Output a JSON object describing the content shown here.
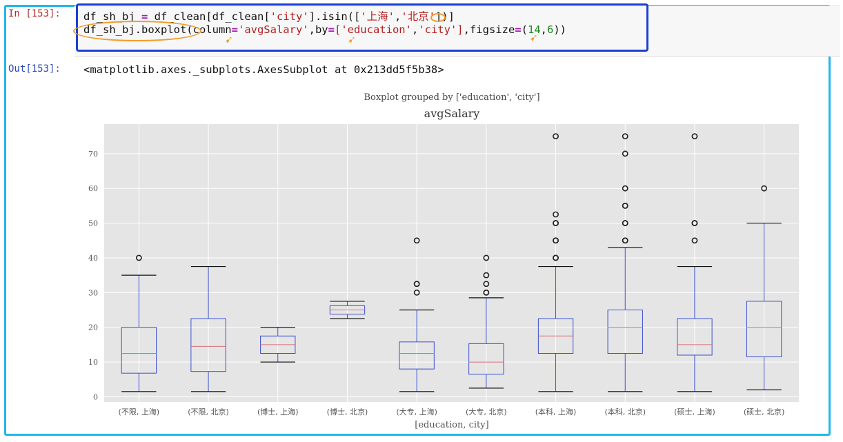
{
  "cell": {
    "in_prompt": "In [153]:",
    "out_prompt": "Out[153]:",
    "code_line1_parts": [
      "df_sh_bj ",
      "=",
      " df_clean[df_clean[",
      "'city'",
      "].isin([",
      "'上海'",
      ",",
      "'北京'",
      "])]"
    ],
    "code_line2_parts": [
      "df_sh_bj.boxplot(column",
      "=",
      "'avgSalary'",
      ",by",
      "=",
      "['education'",
      ",",
      "'city']",
      ",figsize",
      "=",
      "(",
      "14",
      ",",
      "6",
      "))"
    ],
    "output_text": "<matplotlib.axes._subplots.AxesSubplot at 0x213dd5f5b38>"
  },
  "colors": {
    "frame": "#1fb7e8",
    "code_box": "#1a3fd4",
    "highlight": "#f39c27",
    "box": "#3b4fcf",
    "median": "#d6707a",
    "plot_bg": "#e5e5e5"
  },
  "chart_data": {
    "type": "boxplot",
    "suptitle": "Boxplot grouped by ['education', 'city']",
    "title": "avgSalary",
    "xlabel": "[education, city]",
    "ylabel": "",
    "ylim": [
      -1.5,
      78.5
    ],
    "yticks": [
      0,
      10,
      20,
      30,
      40,
      50,
      60,
      70
    ],
    "grid": true,
    "categories": [
      "(不限, 上海)",
      "(不限, 北京)",
      "(博士, 上海)",
      "(博士, 北京)",
      "(大专, 上海)",
      "(大专, 北京)",
      "(本科, 上海)",
      "(本科, 北京)",
      "(硕士, 上海)",
      "(硕士, 北京)"
    ],
    "boxes": [
      {
        "whislo": 1.5,
        "q1": 6.8,
        "med": 12.5,
        "q3": 20,
        "whishi": 35,
        "fliers": [
          40
        ]
      },
      {
        "whislo": 1.5,
        "q1": 7.3,
        "med": 14.5,
        "q3": 22.5,
        "whishi": 37.5,
        "fliers": []
      },
      {
        "whislo": 10,
        "q1": 12.5,
        "med": 15,
        "q3": 17.5,
        "whishi": 20,
        "fliers": []
      },
      {
        "whislo": 22.5,
        "q1": 23.8,
        "med": 25,
        "q3": 26.2,
        "whishi": 27.5,
        "fliers": []
      },
      {
        "whislo": 1.5,
        "q1": 8,
        "med": 12.5,
        "q3": 15.8,
        "whishi": 25,
        "fliers": [
          30,
          32.5,
          32.5,
          45
        ]
      },
      {
        "whislo": 2.5,
        "q1": 6.5,
        "med": 10,
        "q3": 15.3,
        "whishi": 28.5,
        "fliers": [
          30,
          30,
          32.5,
          35,
          40
        ]
      },
      {
        "whislo": 1.5,
        "q1": 12.5,
        "med": 17.5,
        "q3": 22.5,
        "whishi": 37.5,
        "fliers": [
          40,
          40,
          45,
          45,
          50,
          50,
          52.5,
          75
        ]
      },
      {
        "whislo": 1.5,
        "q1": 12.5,
        "med": 20,
        "q3": 25,
        "whishi": 43,
        "fliers": [
          45,
          45,
          50,
          50,
          55,
          55,
          60,
          70,
          75
        ]
      },
      {
        "whislo": 1.5,
        "q1": 12,
        "med": 15,
        "q3": 22.5,
        "whishi": 37.5,
        "fliers": [
          45,
          50,
          50,
          75
        ]
      },
      {
        "whislo": 2,
        "q1": 11.5,
        "med": 20,
        "q3": 27.5,
        "whishi": 50,
        "fliers": [
          60
        ]
      }
    ]
  }
}
